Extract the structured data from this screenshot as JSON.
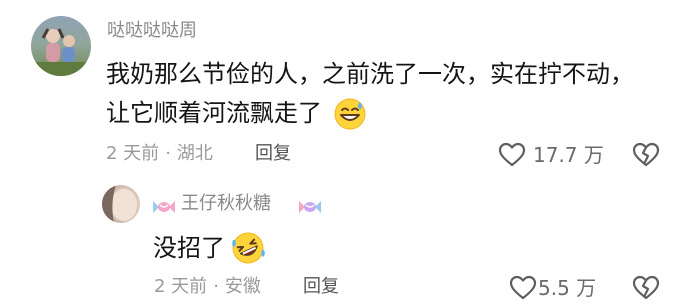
{
  "comment": {
    "author": "哒哒哒哒周",
    "avatar_icon": "child-photo-avatar",
    "text_line1": "我奶那么节俭的人，之前洗了一次，实在拧不动，",
    "text_line2": "让它顺着河流飘走了",
    "emoji": "grinning-sweat-emoji",
    "time": "2 天前",
    "location": "湖北",
    "separator": "·",
    "reply_label": "回复",
    "likes": "17.7 万",
    "like_icon": "heart-icon",
    "dislike_icon": "broken-heart-icon"
  },
  "reply": {
    "author": "王仔秋秋糖",
    "avatar_icon": "face-photo-avatar",
    "decoration_icon": "candy-icon",
    "text": "没招了",
    "emoji": "rolling-on-floor-laughing-emoji",
    "time": "2 天前",
    "location": "安徽",
    "separator": "·",
    "reply_label": "回复",
    "likes": "5.5 万",
    "like_icon": "heart-icon",
    "dislike_icon": "broken-heart-icon"
  },
  "colors": {
    "username": "#8a8a8a",
    "meta": "#9a9a9a",
    "text": "#141414",
    "icon": "#5e5e5e",
    "emoji_face": "#ffd43b",
    "candy_pink": "#f3a6c8",
    "candy_blue": "#9ac9f0"
  }
}
